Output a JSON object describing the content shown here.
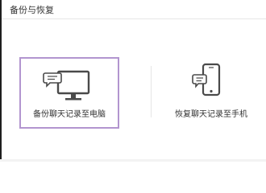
{
  "window": {
    "title": "备份与恢复"
  },
  "options": [
    {
      "label": "备份聊天记录至电脑",
      "icon": "monitor-chat-icon",
      "selected": true
    },
    {
      "label": "恢复聊天记录至手机",
      "icon": "phone-chat-icon",
      "selected": false
    }
  ],
  "colors": {
    "selected_border": "#b295cf",
    "text": "#333333",
    "icon_stroke": "#4a4a4a"
  }
}
